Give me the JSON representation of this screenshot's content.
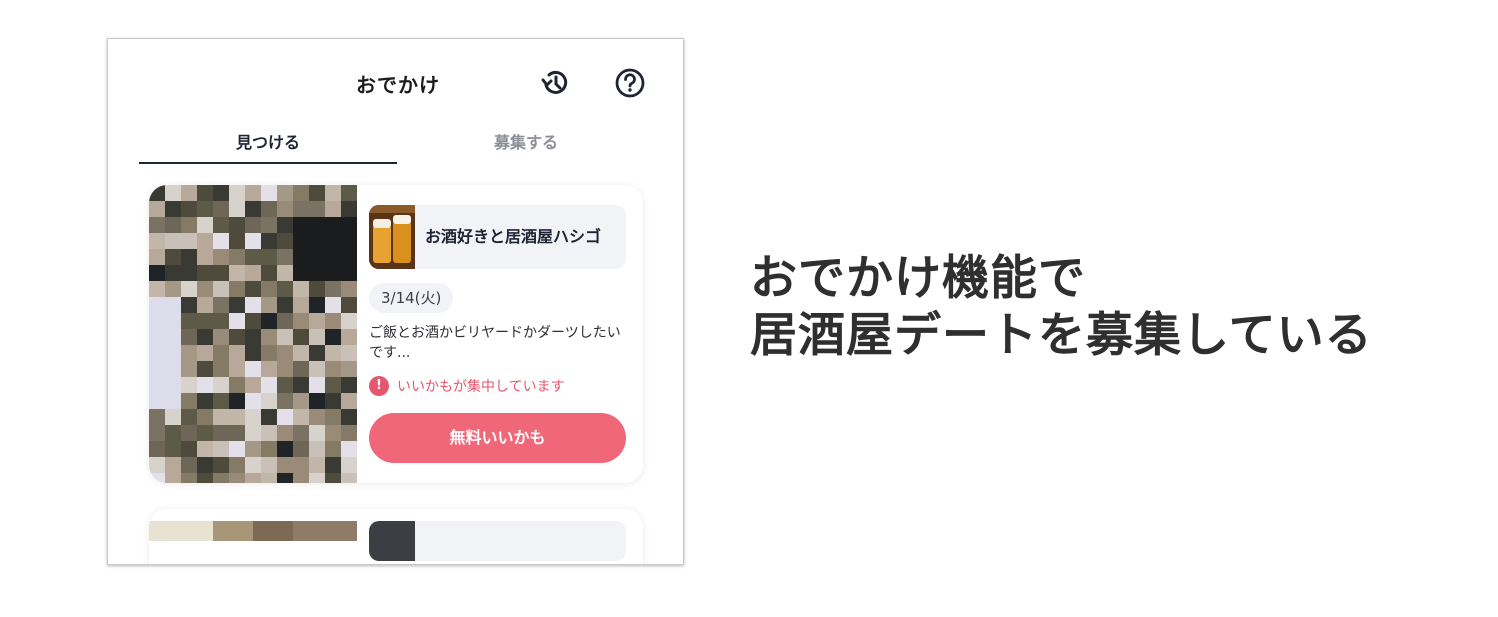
{
  "header": {
    "title": "おでかけ",
    "history_icon": "history-icon",
    "help_icon": "help-icon"
  },
  "tabs": [
    {
      "label": "見つける",
      "active": true
    },
    {
      "label": "募集する",
      "active": false
    }
  ],
  "card": {
    "spot_title": "お酒好きと居酒屋ハシゴ",
    "date": "3/14(火)",
    "description": "ご飯とお酒かビリヤードかダーツしたいです...",
    "alert": "いいかもが集中しています",
    "like_button": "無料いいかも"
  },
  "headline": {
    "line1": "おでかけ機能で",
    "line2": "居酒屋デートを募集している"
  },
  "colors": {
    "accent": "#f0677a",
    "alert": "#e4576d",
    "text_dark": "#1e2433"
  }
}
